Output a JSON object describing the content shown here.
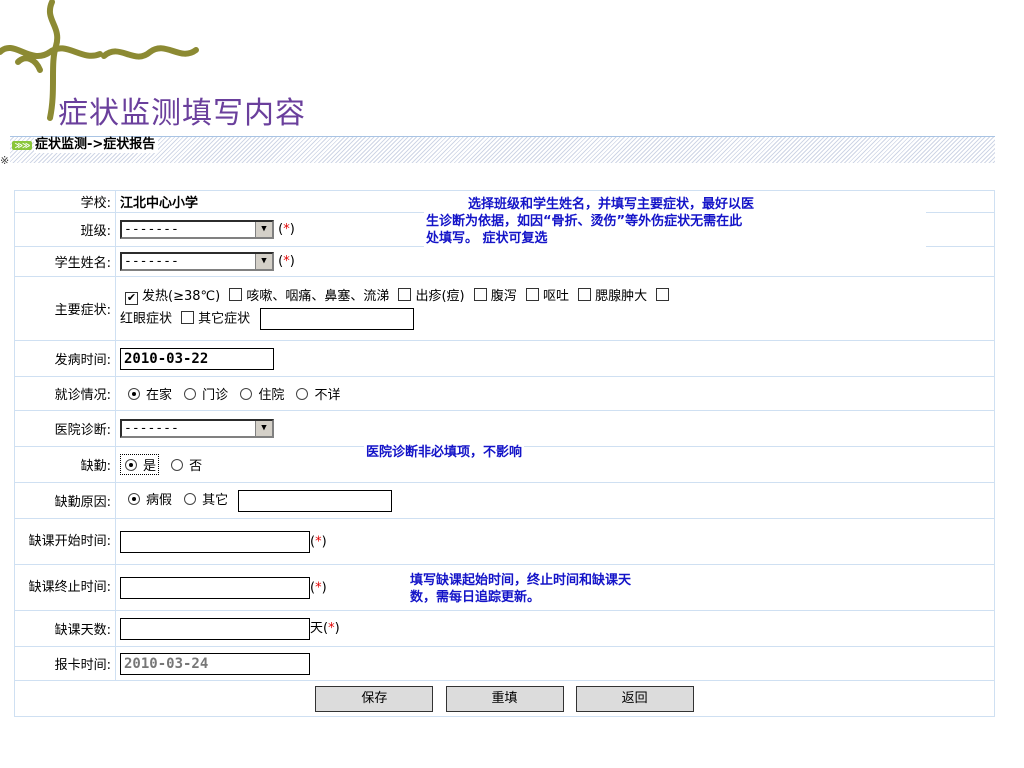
{
  "slide": {
    "title": "症状监测填写内容",
    "stray_char": "※"
  },
  "section": {
    "arrow": "≫≫",
    "breadcrumb": "症状监测->症状报告"
  },
  "form": {
    "school_label": "学校:",
    "school_value": "江北中心小学",
    "class_label": "班级:",
    "class_value": "-------",
    "student_label": "学生姓名:",
    "student_value": "-------",
    "symptoms_label": "主要症状:",
    "symptoms": [
      {
        "label": "发热(≥38℃)",
        "checked": true
      },
      {
        "label": "咳嗽、咽痛、鼻塞、流涕",
        "checked": false
      },
      {
        "label": "出疹(痘)",
        "checked": false
      },
      {
        "label": "腹泻",
        "checked": false
      },
      {
        "label": "呕吐",
        "checked": false
      },
      {
        "label": "腮腺肿大",
        "checked": false
      },
      {
        "label": "红眼症状",
        "checked": false
      },
      {
        "label": "其它症状",
        "checked": false
      }
    ],
    "other_symptom_value": "",
    "onset_label": "发病时间:",
    "onset_value": "2010-03-22",
    "visit_label": "就诊情况:",
    "visit_options": [
      {
        "label": "在家",
        "selected": true
      },
      {
        "label": "门诊",
        "selected": false
      },
      {
        "label": "住院",
        "selected": false
      },
      {
        "label": "不详",
        "selected": false
      }
    ],
    "diagnosis_label": "医院诊断:",
    "diagnosis_value": "-------",
    "absent_label": "缺勤:",
    "absent_options": [
      {
        "label": "是",
        "selected": true
      },
      {
        "label": "否",
        "selected": false
      }
    ],
    "absent_reason_label": "缺勤原因:",
    "absent_reason_options": [
      {
        "label": "病假",
        "selected": true
      },
      {
        "label": "其它",
        "selected": false
      }
    ],
    "absent_reason_other_value": "",
    "start_label": "缺课开始时间:",
    "start_value": "",
    "end_label": "缺课终止时间:",
    "end_value": "",
    "days_label": "缺课天数:",
    "days_value": "",
    "days_unit": "天",
    "report_label": "报卡时间:",
    "report_value": "2010-03-24",
    "required_mark": "(*)",
    "buttons": {
      "save": "保存",
      "reset": "重填",
      "back": "返回"
    }
  },
  "notes": {
    "note1": "选择班级和学生姓名，并填写主要症状，最好以医生诊断为依据，如因“骨折、烫伤”等外伤症状无需在此处填写。 症状可复选",
    "note1_line1": "选择班级和学生姓名，并填写主要症状，最好以医",
    "note1_line2": "生诊断为依据，如因“骨折、烫伤”等外伤症状无需在此",
    "note1_line3": "处填写。 症状可复选",
    "note2": "医院诊断非必填项，不影响",
    "note3_line1": "填写缺课起始时间，终止时间和缺课天",
    "note3_line2": "数，需每日追踪更新。"
  },
  "colors": {
    "title": "#6a3f9c",
    "note_text": "#1414c8",
    "required_star": "#e00000",
    "deco_vine": "#8c8a33"
  }
}
